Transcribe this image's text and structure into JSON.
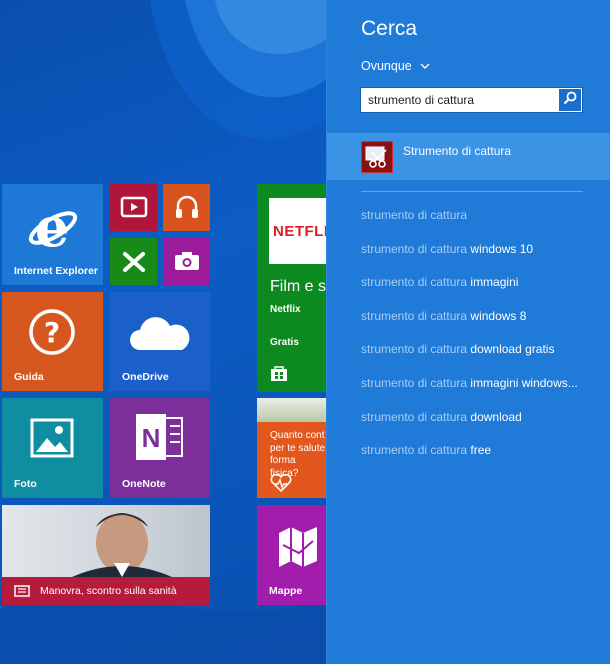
{
  "start_screen": {
    "tiles": {
      "internet_explorer": "Internet Explorer",
      "guida": "Guida",
      "onedrive": "OneDrive",
      "foto": "Foto",
      "onenote": "OneNote",
      "news": "Manovra, scontro sulla sanità",
      "netflix_logo": "NETFLIX",
      "netflix_title": "Film e s",
      "netflix_publisher": "Netflix",
      "netflix_price": "Gratis",
      "health_text": "Quanto cont per te salute forma fisica?",
      "mappe": "Mappe"
    },
    "colors": {
      "ie": "#1e78d6",
      "guida": "#d6561f",
      "onedrive": "#1b5fc9",
      "foto": "#0e8ea0",
      "onenote": "#7d2f9c",
      "video": "#b1163a",
      "music": "#d9531e",
      "games": "#178a17",
      "camera": "#9c1c9c",
      "netflix": "#0c8a1f",
      "health": "#e2571d",
      "mappe": "#a21dab"
    }
  },
  "search": {
    "title": "Cerca",
    "scope": "Ovunque",
    "query": "strumento di cattura",
    "top_result": "Strumento di cattura",
    "suggestions": [
      {
        "prefix": "strumento di cattura",
        "suffix": ""
      },
      {
        "prefix": "strumento di cattura",
        "suffix": " windows 10"
      },
      {
        "prefix": "strumento di cattura",
        "suffix": " immagini"
      },
      {
        "prefix": "strumento di cattura",
        "suffix": " windows 8"
      },
      {
        "prefix": "strumento di cattura",
        "suffix": " download gratis"
      },
      {
        "prefix": "strumento di cattura",
        "suffix": " immagini windows..."
      },
      {
        "prefix": "strumento di cattura",
        "suffix": " download"
      },
      {
        "prefix": "strumento di cattura",
        "suffix": " free"
      }
    ]
  }
}
